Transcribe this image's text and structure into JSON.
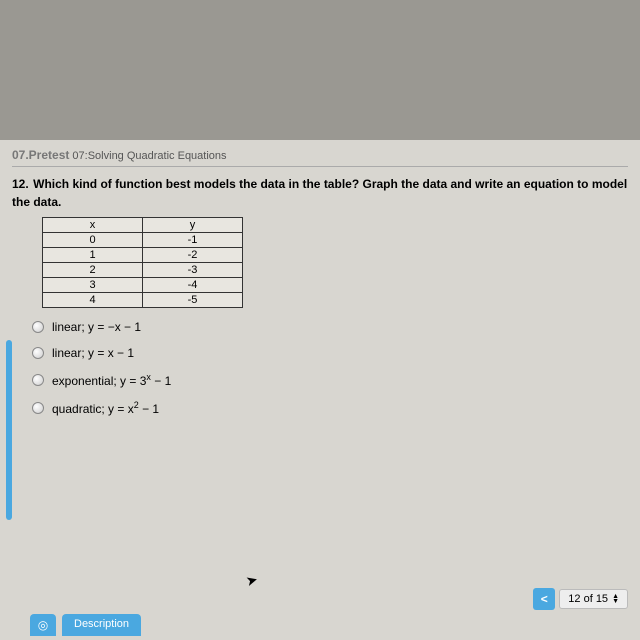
{
  "header": {
    "chapter_bold": "07.Pretest",
    "chapter_rest": " 07:Solving Quadratic Equations"
  },
  "question": {
    "number": "12.",
    "text": " Which kind of function best models the data in the table? Graph the data and write an equation to model the data."
  },
  "table": {
    "headers": [
      "x",
      "y"
    ],
    "rows": [
      [
        "0",
        "-1"
      ],
      [
        "1",
        "-2"
      ],
      [
        "2",
        "-3"
      ],
      [
        "3",
        "-4"
      ],
      [
        "4",
        "-5"
      ]
    ]
  },
  "options": {
    "a": "linear; y = −x − 1",
    "b": "linear; y = x − 1",
    "c_prefix": "exponential; y = 3",
    "c_sup": "x",
    "c_suffix": " − 1",
    "d_prefix": "quadratic; y = x",
    "d_sup": "2",
    "d_suffix": " − 1"
  },
  "footer": {
    "prev_symbol": "<",
    "page_indicator": "12 of 15"
  },
  "tabs": {
    "description": "Description",
    "icon_symbol": "◎"
  },
  "chart_data": {
    "type": "table",
    "columns": [
      "x",
      "y"
    ],
    "data": [
      {
        "x": 0,
        "y": -1
      },
      {
        "x": 1,
        "y": -2
      },
      {
        "x": 2,
        "y": -3
      },
      {
        "x": 3,
        "y": -4
      },
      {
        "x": 4,
        "y": -5
      }
    ]
  }
}
